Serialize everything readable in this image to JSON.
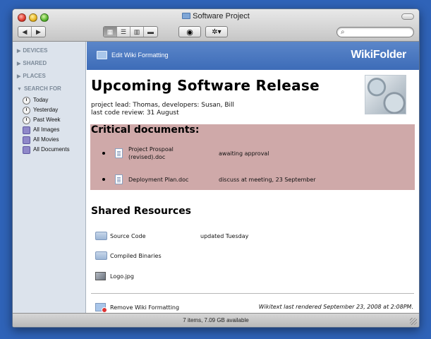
{
  "window": {
    "title": "Software Project"
  },
  "toolbar": {
    "back_icon": "back-arrow-icon",
    "forward_icon": "forward-arrow-icon",
    "view_modes": [
      "icon-view",
      "list-view",
      "column-view",
      "coverflow-view"
    ],
    "active_view": "icon-view",
    "quicklook_icon": "eye-icon",
    "action_icon": "gear-icon",
    "search_placeholder": ""
  },
  "sidebar": {
    "sections": [
      {
        "label": "DEVICES"
      },
      {
        "label": "SHARED"
      },
      {
        "label": "PLACES"
      },
      {
        "label": "SEARCH FOR"
      }
    ],
    "search_items": [
      {
        "label": "Today",
        "icon": "clock-icon"
      },
      {
        "label": "Yesterday",
        "icon": "clock-icon"
      },
      {
        "label": "Past Week",
        "icon": "clock-icon"
      },
      {
        "label": "All Images",
        "icon": "smart-folder-icon"
      },
      {
        "label": "All Movies",
        "icon": "smart-folder-icon"
      },
      {
        "label": "All Documents",
        "icon": "smart-folder-icon"
      }
    ]
  },
  "wiki": {
    "edit_label": "Edit Wiki Formatting",
    "logo": "WikiFolder",
    "remove_label": "Remove Wiki Formatting",
    "rendered_note": "Wikitext last rendered September 23, 2008 at 2:08PM."
  },
  "document": {
    "title": "Upcoming Software Release",
    "meta_line1": "project lead: Thomas, developers: Susan, Bill",
    "meta_line2": "last code review: 31 August",
    "critical_heading": "Critical documents:",
    "critical_items": [
      {
        "name_line1": "Project Prospoal",
        "name_line2": "(revised).doc",
        "status": "awaiting approval"
      },
      {
        "name_line1": "Deployment Plan.doc",
        "name_line2": "",
        "status": "discuss at meeting, 23 September"
      }
    ],
    "shared_heading": "Shared Resources",
    "shared_items": [
      {
        "name": "Source Code",
        "note": "updated Tuesday",
        "icon": "folder-icon"
      },
      {
        "name": "Compiled Binaries",
        "note": "",
        "icon": "folder-icon"
      },
      {
        "name": "Logo.jpg",
        "note": "",
        "icon": "image-file-icon"
      }
    ]
  },
  "status": {
    "text": "7 items, 7.09 GB available"
  },
  "colors": {
    "desktop": "#2f63b8",
    "wiki_bar": "#4a78c0",
    "critical_bg": "#cfa9a9",
    "sidebar_bg": "#dce3ec"
  }
}
